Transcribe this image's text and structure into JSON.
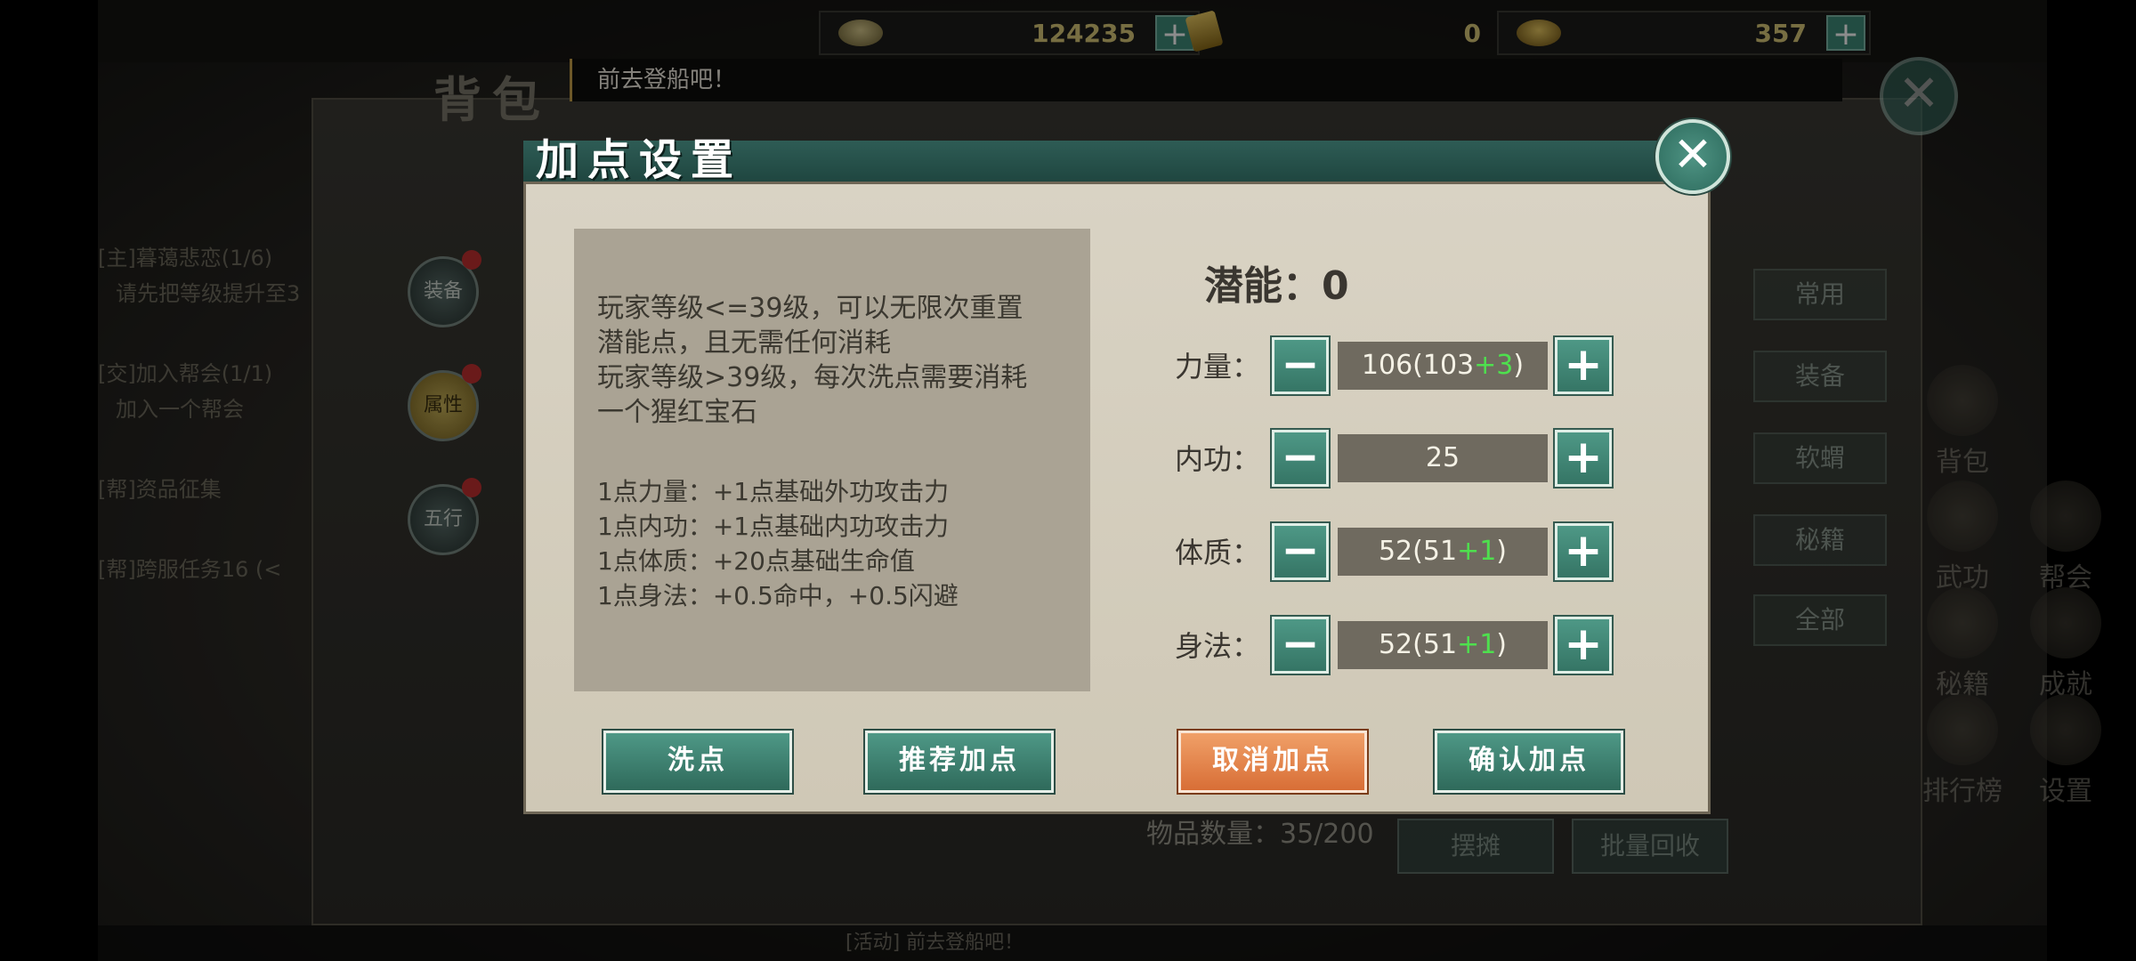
{
  "resources": [
    {
      "icon": "silver-ingot-icon",
      "value": "124235"
    },
    {
      "icon": "gold-bar-icon",
      "value": "0"
    },
    {
      "icon": "gold-ingot-icon",
      "value": "357"
    }
  ],
  "background": {
    "bag_title": "背包",
    "notice": "前去登船吧！",
    "tasks": [
      "[主]暮蔼悲恋(1/6)",
      "请先把等级提升至3",
      "[交]加入帮会(1/1)",
      "加入一个帮会",
      "[帮]资品征集",
      "[帮]跨服任务16 (<"
    ],
    "side_medals": [
      "装备",
      "属性",
      "五行"
    ],
    "right_menu": [
      "常用",
      "装备",
      "软蝟",
      "秘籍",
      "全部"
    ],
    "right_icons": [
      "背包",
      "武功",
      "帮会",
      "秘籍",
      "成就",
      "排行榜",
      "设置"
    ],
    "item_count": "物品数量：35/200",
    "bottom_buttons": [
      "摆摊",
      "批量回收"
    ],
    "bottom_bar": "[活动] 前去登船吧！"
  },
  "dialog": {
    "title": "加点设置",
    "info_lines": [
      "玩家等级<=39级，可以无限次重置",
      "潜能点，且无需任何消耗",
      "玩家等级>39级，每次洗点需要消耗",
      "一个猩红宝石"
    ],
    "effect_lines": [
      "1点力量：+1点基础外功攻击力",
      "1点内功：+1点基础内功攻击力",
      "1点体质：+20点基础生命值",
      "1点身法：+0.5命中，+0.5闪避"
    ],
    "potential": "潜能：0",
    "stats": [
      {
        "label": "力量：",
        "total": "106",
        "base": "103",
        "added": "+3"
      },
      {
        "label": "内功：",
        "total": "25",
        "base": "",
        "added": ""
      },
      {
        "label": "体质：",
        "total": "52",
        "base": "51",
        "added": "+1"
      },
      {
        "label": "身法：",
        "total": "52",
        "base": "51",
        "added": "+1"
      }
    ],
    "buttons": {
      "reset": "洗点",
      "recommend": "推荐加点",
      "cancel": "取消加点",
      "confirm": "确认加点"
    }
  },
  "colors": {
    "accent": "#3f8a78",
    "cancel_button": "#e98a4e",
    "added_value": "#4ee04e"
  }
}
